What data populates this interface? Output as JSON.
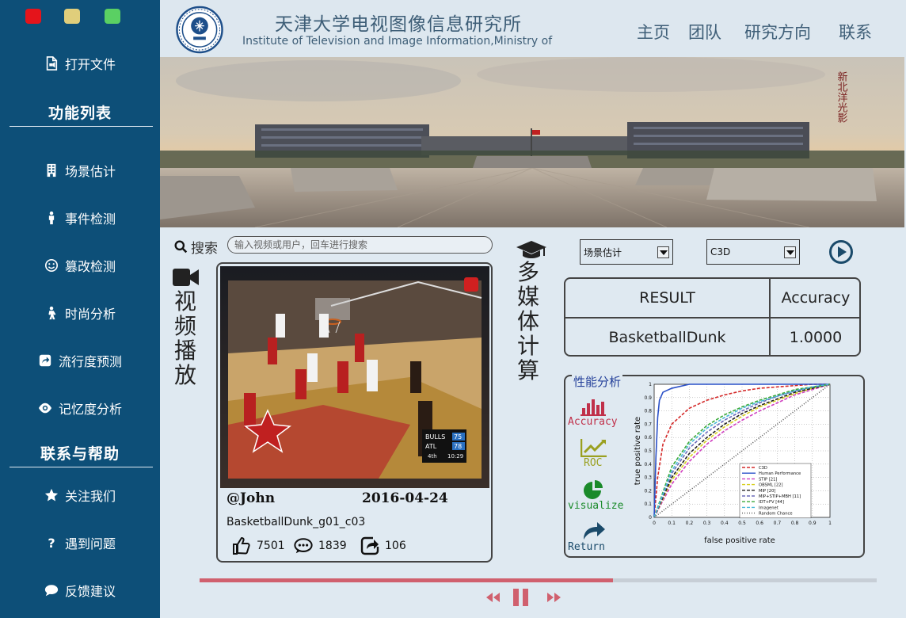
{
  "window": {
    "controls": [
      "close",
      "minimize",
      "maximize"
    ],
    "colors": {
      "close": "#e5141b",
      "minimize": "#e0ce7b",
      "maximize": "#5ad063"
    }
  },
  "sidebar": {
    "open_file": {
      "label": "打开文件",
      "icon": "file-icon"
    },
    "function_header": "功能列表",
    "functions": [
      {
        "label": "场景估计",
        "icon": "building-icon"
      },
      {
        "label": "事件检测",
        "icon": "person-icon"
      },
      {
        "label": "篡改检测",
        "icon": "smiley-icon"
      },
      {
        "label": "时尚分析",
        "icon": "fashion-person-icon"
      },
      {
        "label": "流行度预测",
        "icon": "share-icon"
      },
      {
        "label": "记忆度分析",
        "icon": "eye-icon"
      }
    ],
    "help_header": "联系与帮助",
    "help_items": [
      {
        "label": "关注我们",
        "icon": "star-icon"
      },
      {
        "label": "遇到问题",
        "icon": "question-icon"
      },
      {
        "label": "反馈建议",
        "icon": "comment-icon"
      }
    ],
    "bg_color": "#0d4f78"
  },
  "header": {
    "title_cn": "天津大学电视图像信息研究所",
    "title_en": "Institute of Television and Image Information,Ministry of Education",
    "nav": [
      "主页",
      "团队",
      "研究方向",
      "联系"
    ]
  },
  "banner": {
    "calligraphy": "新北洋光影"
  },
  "search": {
    "label": "搜索",
    "placeholder": "输入视频或用户，回车进行搜索"
  },
  "video_section": {
    "title": "视频播放",
    "scoreboard": {
      "team1": "BULLS",
      "score1": "75",
      "team2": "ATL",
      "score2": "78",
      "quarter": "4th",
      "clock": "10:29"
    },
    "user": "@John",
    "date": "2016-04-24",
    "filename": "BasketballDunk_g01_c03",
    "likes": "7501",
    "comments": "1839",
    "shares": "106"
  },
  "compute_section": {
    "title": "多媒体计算",
    "task_select": "场景估计",
    "model_select": "C3D"
  },
  "result": {
    "headers": [
      "RESULT",
      "Accuracy"
    ],
    "rows": [
      {
        "label": "BasketballDunk",
        "value": "1.0000"
      }
    ]
  },
  "perf": {
    "title": "性能分析",
    "buttons": [
      {
        "label": "Accuracy",
        "icon": "bar-chart-icon",
        "color": "#c0304a"
      },
      {
        "label": "ROC",
        "icon": "line-chart-icon",
        "color": "#9aa020"
      },
      {
        "label": "visualize",
        "icon": "pie-chart-icon",
        "color": "#1a8a2a"
      },
      {
        "label": "Return",
        "icon": "return-icon",
        "color": "#1a4a6a"
      }
    ]
  },
  "chart_data": {
    "type": "line",
    "title": "",
    "xlabel": "false positive rate",
    "ylabel": "true positive rate",
    "xlim": [
      0,
      1
    ],
    "ylim": [
      0,
      1
    ],
    "xticks": [
      "0",
      "0.1",
      "0.2",
      "0.3",
      "0.4",
      "0.5",
      "0.6",
      "0.7",
      "0.8",
      "0.9",
      "1"
    ],
    "yticks": [
      "0",
      "0.1",
      "0.2",
      "0.3",
      "0.4",
      "0.5",
      "0.6",
      "0.7",
      "0.8",
      "0.9",
      "1"
    ],
    "grid": true,
    "legend_position": "bottom-right",
    "series": [
      {
        "name": "C3D",
        "color": "#d42a2a",
        "dash": "4,2",
        "x": [
          0,
          0.02,
          0.05,
          0.1,
          0.2,
          0.3,
          0.4,
          0.5,
          0.6,
          0.7,
          0.8,
          0.9,
          1
        ],
        "y": [
          0,
          0.3,
          0.55,
          0.7,
          0.82,
          0.88,
          0.92,
          0.95,
          0.97,
          0.98,
          0.99,
          1,
          1
        ]
      },
      {
        "name": "Human Performance",
        "color": "#2a50c8",
        "dash": "",
        "x": [
          0,
          0.01,
          0.02,
          0.03,
          0.05,
          0.1,
          0.2,
          0.5,
          1
        ],
        "y": [
          0,
          0.45,
          0.75,
          0.88,
          0.94,
          0.97,
          1,
          1,
          1
        ]
      },
      {
        "name": "STIP [21]",
        "color": "#d040c0",
        "dash": "4,2",
        "x": [
          0,
          0.1,
          0.2,
          0.3,
          0.4,
          0.5,
          0.6,
          0.7,
          0.8,
          0.9,
          1
        ],
        "y": [
          0,
          0.25,
          0.42,
          0.55,
          0.65,
          0.73,
          0.8,
          0.86,
          0.92,
          0.96,
          1
        ]
      },
      {
        "name": "OBSML [22]",
        "color": "#d8d020",
        "dash": "4,2",
        "x": [
          0,
          0.1,
          0.2,
          0.3,
          0.4,
          0.5,
          0.6,
          0.7,
          0.8,
          0.9,
          1
        ],
        "y": [
          0,
          0.28,
          0.45,
          0.58,
          0.68,
          0.76,
          0.83,
          0.88,
          0.93,
          0.97,
          1
        ]
      },
      {
        "name": "MIP [20]",
        "color": "#202020",
        "dash": "4,2",
        "x": [
          0,
          0.1,
          0.2,
          0.3,
          0.4,
          0.5,
          0.6,
          0.7,
          0.8,
          0.9,
          1
        ],
        "y": [
          0,
          0.3,
          0.48,
          0.6,
          0.7,
          0.78,
          0.84,
          0.89,
          0.94,
          0.97,
          1
        ]
      },
      {
        "name": "MIP+STIP+MBH [11]",
        "color": "#6a6ab8",
        "dash": "4,2",
        "x": [
          0,
          0.1,
          0.2,
          0.3,
          0.4,
          0.5,
          0.6,
          0.7,
          0.8,
          0.9,
          1
        ],
        "y": [
          0,
          0.33,
          0.52,
          0.64,
          0.73,
          0.8,
          0.86,
          0.91,
          0.95,
          0.98,
          1
        ]
      },
      {
        "name": "IDT+FV [44]",
        "color": "#3aaa3a",
        "dash": "4,2",
        "x": [
          0,
          0.1,
          0.2,
          0.3,
          0.4,
          0.5,
          0.6,
          0.7,
          0.8,
          0.9,
          1
        ],
        "y": [
          0,
          0.38,
          0.57,
          0.69,
          0.77,
          0.83,
          0.88,
          0.92,
          0.96,
          0.98,
          1
        ]
      },
      {
        "name": "Imagenet",
        "color": "#4ab8d8",
        "dash": "4,2",
        "x": [
          0,
          0.1,
          0.2,
          0.3,
          0.4,
          0.5,
          0.6,
          0.7,
          0.8,
          0.9,
          1
        ],
        "y": [
          0,
          0.35,
          0.55,
          0.67,
          0.75,
          0.82,
          0.87,
          0.91,
          0.95,
          0.98,
          1
        ]
      },
      {
        "name": "Random Chance",
        "color": "#555555",
        "dash": "1,2",
        "x": [
          0,
          1
        ],
        "y": [
          0,
          1
        ]
      }
    ]
  },
  "player": {
    "progress": 0.61
  }
}
